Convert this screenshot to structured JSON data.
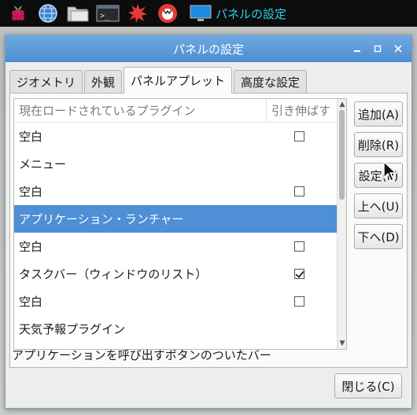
{
  "taskbar": {
    "icons": [
      "raspberry-menu-icon",
      "web-browser-icon",
      "file-manager-icon",
      "terminal-icon",
      "mathematica-icon",
      "wolfram-icon"
    ],
    "active_window_title": "パネルの設定"
  },
  "window": {
    "title": "パネルの設定",
    "controls": [
      "minimize-icon",
      "maximize-icon",
      "close-icon"
    ]
  },
  "tabs": [
    {
      "label": "ジオメトリ",
      "active": false
    },
    {
      "label": "外観",
      "active": false
    },
    {
      "label": "パネルアプレット",
      "active": true
    },
    {
      "label": "高度な設定",
      "active": false
    }
  ],
  "list": {
    "columns": [
      "現在ロードされているプラグイン",
      "引き伸ばす"
    ],
    "rows": [
      {
        "name": "空白",
        "stretch": "unchecked"
      },
      {
        "name": "メニュー",
        "stretch": "none"
      },
      {
        "name": "空白",
        "stretch": "unchecked"
      },
      {
        "name": "アプリケーション・ランチャー",
        "stretch": "none",
        "selected": true
      },
      {
        "name": "空白",
        "stretch": "unchecked"
      },
      {
        "name": "タスクバー（ウィンドウのリスト）",
        "stretch": "checked"
      },
      {
        "name": "空白",
        "stretch": "unchecked"
      },
      {
        "name": "天気予報プラグイン",
        "stretch": "none"
      }
    ]
  },
  "buttons": {
    "add": "追加(A)",
    "remove": "削除(R)",
    "settings": "設定(P)",
    "up": "上へ(U)",
    "down": "下へ(D)",
    "close": "閉じる(C)"
  },
  "description": "アプリケーションを呼び出すボタンのついたバー",
  "colors": {
    "accent": "#4e8fd6",
    "titlebar": "#5a9ad9",
    "taskbar_text": "#2bd3e8"
  }
}
